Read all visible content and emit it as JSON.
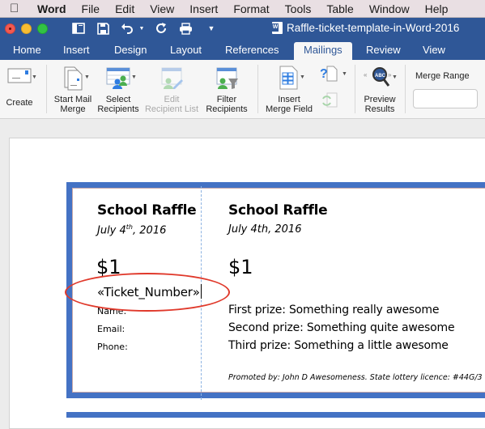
{
  "menubar": {
    "apple_icon": "apple-logo-icon",
    "app_name": "Word",
    "items": [
      "File",
      "Edit",
      "View",
      "Insert",
      "Format",
      "Tools",
      "Table",
      "Window",
      "Help"
    ]
  },
  "titlebar": {
    "document_title": "Raffle-ticket-template-in-Word-2016",
    "quick_access": [
      "sidebar-icon",
      "save-icon",
      "undo-icon",
      "redo-icon",
      "print-icon",
      "customize-icon"
    ]
  },
  "ribbon_tabs": {
    "items": [
      "Home",
      "Insert",
      "Design",
      "Layout",
      "References",
      "Mailings",
      "Review",
      "View"
    ],
    "active": "Mailings"
  },
  "ribbon": {
    "create": "Create",
    "start_mail_merge": [
      "Start Mail",
      "Merge"
    ],
    "select_recipients": [
      "Select",
      "Recipients"
    ],
    "edit_recipient_list": [
      "Edit",
      "Recipient List"
    ],
    "filter_recipients": [
      "Filter",
      "Recipients"
    ],
    "insert_merge_field": [
      "Insert",
      "Merge Field"
    ],
    "preview_results": [
      "Preview",
      "Results"
    ],
    "merge_range_label": "Merge Range",
    "merge_range_value": ""
  },
  "ticket": {
    "stub": {
      "title": "School Raffle",
      "date_prefix": "July 4",
      "date_sup": "th",
      "date_suffix": ", 2016",
      "price": "$1",
      "merge_field": "«Ticket_Number»",
      "fields": [
        "Name:",
        "Email:",
        "Phone:"
      ]
    },
    "main": {
      "title": "School Raffle",
      "date": "July 4th, 2016",
      "price": "$1",
      "prizes": [
        "First prize: Something really awesome",
        "Second prize: Something quite awesome",
        "Third prize: Something a little awesome"
      ],
      "promoted_by": "Promoted by: John D Awesomeness. State lottery licence: #44G/3"
    }
  },
  "colors": {
    "titlebar": "#2f5797",
    "ticket_border": "#4472c4",
    "highlight": "#e0392b"
  }
}
